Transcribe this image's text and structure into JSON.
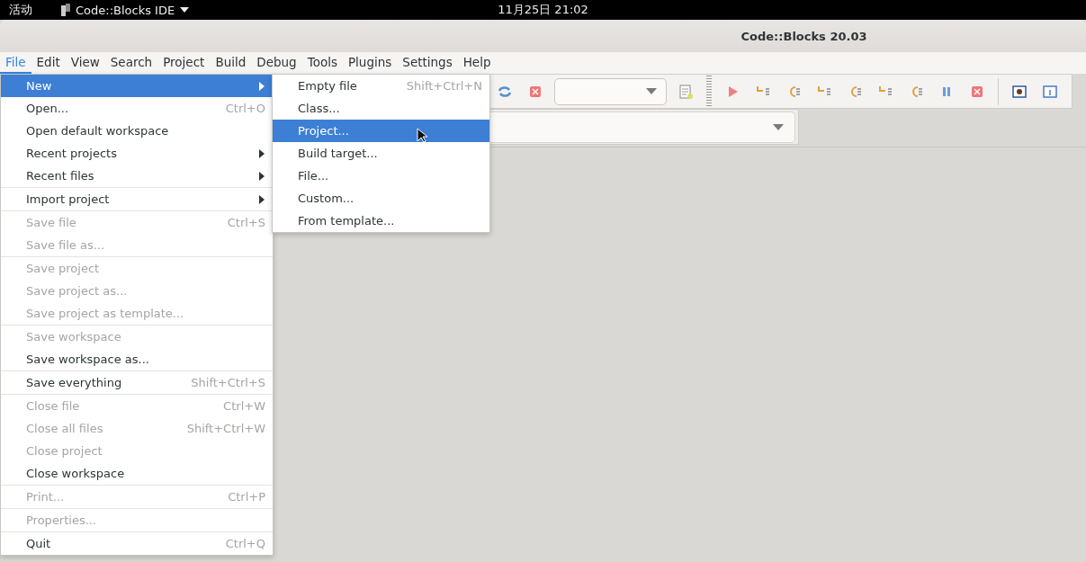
{
  "top_bar": {
    "activities": "活动",
    "app_menu": "Code::Blocks IDE",
    "clock": "11月25日 21:02"
  },
  "window": {
    "title": "Code::Blocks 20.03"
  },
  "menu_bar": [
    {
      "label": "File",
      "selected": true
    },
    {
      "label": "Edit",
      "selected": false
    },
    {
      "label": "View",
      "selected": false
    },
    {
      "label": "Search",
      "selected": false
    },
    {
      "label": "Project",
      "selected": false
    },
    {
      "label": "Build",
      "selected": false
    },
    {
      "label": "Debug",
      "selected": false
    },
    {
      "label": "Tools",
      "selected": false
    },
    {
      "label": "Plugins",
      "selected": false
    },
    {
      "label": "Settings",
      "selected": false
    },
    {
      "label": "Help",
      "selected": false
    }
  ],
  "file_menu": [
    [
      {
        "label": "New",
        "submenu": true,
        "selected": true,
        "disabled": false
      },
      {
        "label": "Open...",
        "shortcut": "Ctrl+O",
        "selected": false,
        "disabled": false
      },
      {
        "label": "Open default workspace",
        "selected": false,
        "disabled": false
      },
      {
        "label": "Recent projects",
        "submenu": true,
        "selected": false,
        "disabled": false
      },
      {
        "label": "Recent files",
        "submenu": true,
        "selected": false,
        "disabled": false
      }
    ],
    [
      {
        "label": "Import project",
        "submenu": true,
        "selected": false,
        "disabled": false
      }
    ],
    [
      {
        "label": "Save file",
        "shortcut": "Ctrl+S",
        "selected": false,
        "disabled": true
      },
      {
        "label": "Save file as...",
        "selected": false,
        "disabled": true
      }
    ],
    [
      {
        "label": "Save project",
        "selected": false,
        "disabled": true
      },
      {
        "label": "Save project as...",
        "selected": false,
        "disabled": true
      },
      {
        "label": "Save project as template...",
        "selected": false,
        "disabled": true
      }
    ],
    [
      {
        "label": "Save workspace",
        "selected": false,
        "disabled": true
      },
      {
        "label": "Save workspace as...",
        "selected": false,
        "disabled": false
      }
    ],
    [
      {
        "label": "Save everything",
        "shortcut": "Shift+Ctrl+S",
        "selected": false,
        "disabled": false
      }
    ],
    [
      {
        "label": "Close file",
        "shortcut": "Ctrl+W",
        "selected": false,
        "disabled": true
      },
      {
        "label": "Close all files",
        "shortcut": "Shift+Ctrl+W",
        "selected": false,
        "disabled": true
      },
      {
        "label": "Close project",
        "selected": false,
        "disabled": true
      },
      {
        "label": "Close workspace",
        "selected": false,
        "disabled": false
      }
    ],
    [
      {
        "label": "Print...",
        "shortcut": "Ctrl+P",
        "selected": false,
        "disabled": true
      }
    ],
    [
      {
        "label": "Properties...",
        "selected": false,
        "disabled": true
      }
    ],
    [
      {
        "label": "Quit",
        "shortcut": "Ctrl+Q",
        "selected": false,
        "disabled": false
      }
    ]
  ],
  "new_submenu": [
    {
      "label": "Empty file",
      "shortcut": "Shift+Ctrl+N",
      "selected": false
    },
    {
      "label": "Class...",
      "selected": false
    },
    {
      "label": "Project...",
      "selected": true
    },
    {
      "label": "Build target...",
      "selected": false
    },
    {
      "label": "File...",
      "selected": false
    },
    {
      "label": "Custom...",
      "selected": false
    },
    {
      "label": "From template...",
      "selected": false
    }
  ]
}
